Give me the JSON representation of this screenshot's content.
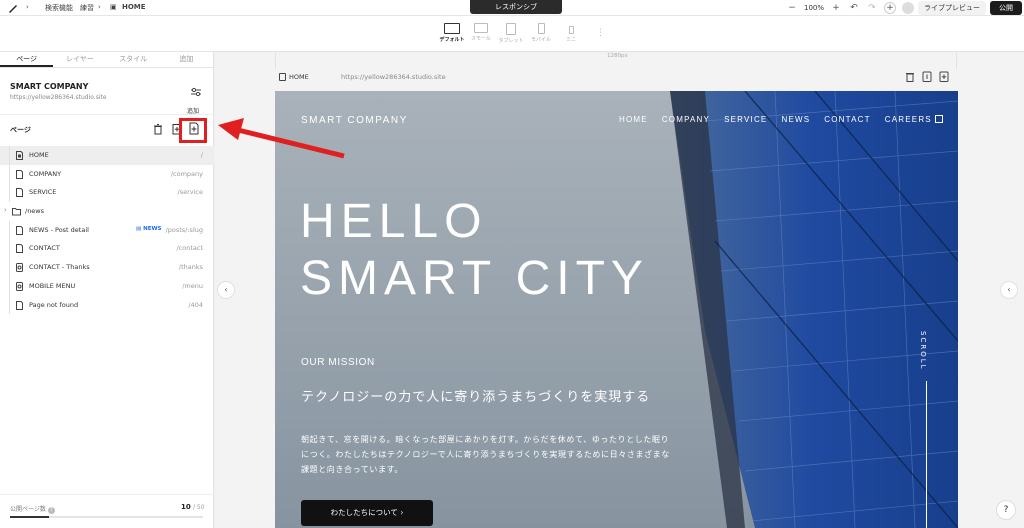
{
  "topbar": {
    "crumb1": "検索機能　練習",
    "crumb2": "HOME",
    "responsive": "レスポンシブ",
    "zoom": "100%",
    "live_preview": "ライブプレビュー",
    "publish": "公開"
  },
  "devices": [
    {
      "label": "デフォルト",
      "active": true
    },
    {
      "label": "スモール",
      "active": false
    },
    {
      "label": "タブレット",
      "active": false
    },
    {
      "label": "モバイル",
      "active": false
    },
    {
      "label": "ミニ",
      "active": false
    }
  ],
  "left_panel": {
    "tabs": [
      "ページ",
      "レイヤー",
      "スタイル",
      "追加"
    ],
    "site_name": "SMART COMPANY",
    "site_url": "https://yellow286364.studio.site",
    "add_label": "追加",
    "pages_label": "ページ",
    "pages": [
      {
        "name": "HOME",
        "path": "/"
      },
      {
        "name": "COMPANY",
        "path": "/company"
      },
      {
        "name": "SERVICE",
        "path": "/service"
      },
      {
        "name": "/news",
        "path": ""
      },
      {
        "name": "NEWS - Post detail",
        "badge": "NEWS",
        "path": "/posts/:slug"
      },
      {
        "name": "CONTACT",
        "path": "/contact"
      },
      {
        "name": "CONTACT - Thanks",
        "path": "/thanks"
      },
      {
        "name": "MOBILE MENU",
        "path": "/menu"
      },
      {
        "name": "Page not found",
        "path": "/404"
      }
    ],
    "published_label": "公開ページ数",
    "published_count": "10",
    "published_total": "/ 50",
    "published_progress": 0.2
  },
  "canvas": {
    "ruler": "1280px",
    "frame_page": "HOME",
    "frame_url": "https://yellow286364.studio.site"
  },
  "website": {
    "logo": "SMART COMPANY",
    "nav": [
      "HOME",
      "COMPANY",
      "SERVICE",
      "NEWS",
      "CONTACT",
      "CAREERS"
    ],
    "hero_line1": "HELLO",
    "hero_line2": "SMART CITY",
    "mission_label": "OUR MISSION",
    "tagline": "テクノロジーの力で人に寄り添うまちづくりを実現する",
    "body_line1": "朝起きて、窓を開ける。暗くなった部屋にあかりを灯す。からだを休めて、ゆったりとした眠り",
    "body_line2": "につく。わたしたちはテクノロジーで人に寄り添うまちづくりを実現するために日々さまざまな",
    "body_line3": "課題と向き合っています。",
    "cta": "わたしたちについて ›",
    "scroll": "SCROLL"
  },
  "colors": {
    "highlight": "#e02020",
    "badge": "#1d6cf2",
    "building_blue": "#1f4aa0"
  }
}
